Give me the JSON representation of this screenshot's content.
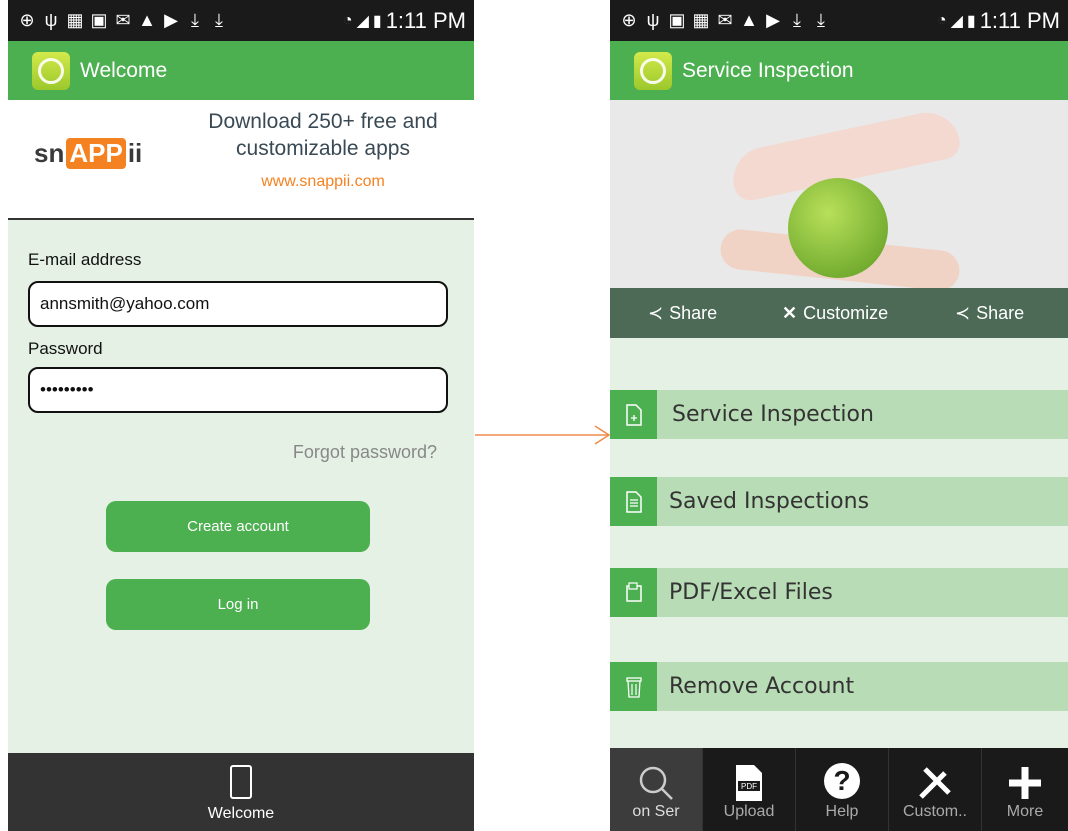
{
  "status_bar": {
    "time": "1:11 PM"
  },
  "left": {
    "title": "Welcome",
    "banner": {
      "logo": {
        "part1": "sn",
        "part2": "APP",
        "part3": "ii"
      },
      "line1": "Download 250+ free and",
      "line2": "customizable apps",
      "link": "www.snappii.com"
    },
    "form": {
      "email_label": "E-mail address",
      "email_value": "annsmith@yahoo.com",
      "password_label": "Password",
      "password_value": "•••••••••",
      "forgot": "Forgot password?",
      "create_account": "Create account",
      "log_in": "Log in"
    },
    "bottom_label": "Welcome"
  },
  "right": {
    "title": "Service Inspection",
    "share_bar": {
      "share1": "Share",
      "customize": "Customize",
      "share2": "Share"
    },
    "menu": [
      {
        "label": "Service Inspection",
        "icon": "new-document-icon"
      },
      {
        "label": "Saved Inspections",
        "icon": "document-icon"
      },
      {
        "label": "PDF/Excel Files",
        "icon": "pdf-file-icon"
      },
      {
        "label": "Remove Account",
        "icon": "trash-icon"
      }
    ],
    "bottom_bar": {
      "search_label": "on Ser",
      "upload": "Upload",
      "help": "Help",
      "customize": "Custom..",
      "more": "More"
    }
  },
  "colors": {
    "accent": "#4caf50",
    "menu_row": "#b8dcb5",
    "arrow": "#f08a4b"
  }
}
